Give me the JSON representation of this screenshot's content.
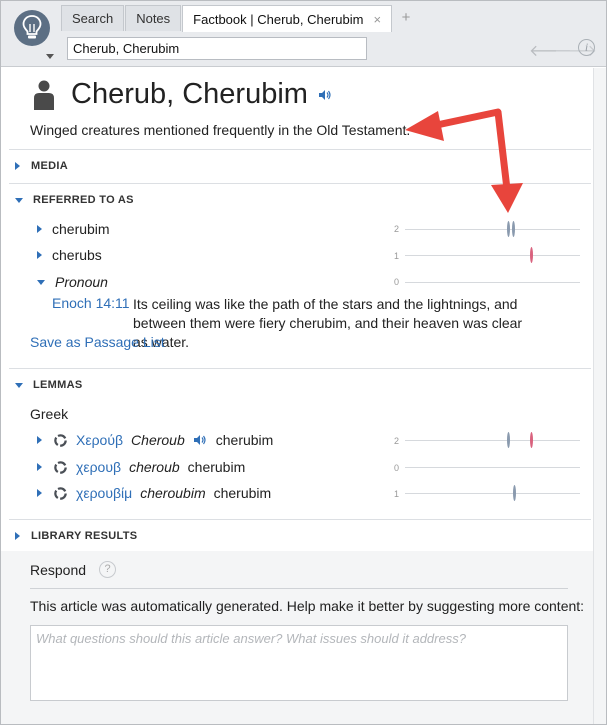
{
  "tabs": [
    {
      "label": "Search"
    },
    {
      "label": "Notes"
    },
    {
      "label": "Factbook | Cherub, Cherubim",
      "active": true
    }
  ],
  "tab_close": "×",
  "tab_add": "+",
  "search": {
    "value": "Cherub, Cherubim"
  },
  "nav": {
    "back": "🡐",
    "forward": "🡒",
    "info": "i"
  },
  "article": {
    "title": "Cherub, Cherubim",
    "description": "Winged creatures mentioned frequently in the Old Testament."
  },
  "sections": {
    "media": "MEDIA",
    "referred_to_as": "REFERRED TO AS",
    "lemmas": "LEMMAS",
    "library_results": "LIBRARY RESULTS"
  },
  "referred": [
    {
      "label": "cherubim",
      "count": "2",
      "italic": false,
      "marks": [
        {
          "pos": 0.59,
          "color": "#8a9aae"
        },
        {
          "pos": 0.615,
          "color": "#8a9aae"
        }
      ]
    },
    {
      "label": "cherubs",
      "count": "1",
      "italic": false,
      "marks": [
        {
          "pos": 0.72,
          "color": "#d9627e"
        }
      ]
    },
    {
      "label": "Pronoun",
      "count": "0",
      "italic": true,
      "marks": []
    }
  ],
  "passage": {
    "reference": "Enoch 14:11",
    "text": "Its ceiling was like the path of the stars and the lightnings, and between them were fiery cherubim, and their heaven was clear as water."
  },
  "save_passage_list": "Save as Passage List",
  "lemmas_label": "Greek",
  "lemmas": [
    {
      "greek": "Χερούβ",
      "translit": "Cheroub",
      "gloss": "cherubim",
      "count": "2",
      "audio": true,
      "marks": [
        {
          "pos": 0.59,
          "color": "#8a9aae"
        },
        {
          "pos": 0.72,
          "color": "#d9627e"
        }
      ]
    },
    {
      "greek": "χερουβ",
      "translit": "cheroub",
      "gloss": "cherubim",
      "count": "0",
      "audio": false,
      "marks": []
    },
    {
      "greek": "χερουβίμ",
      "translit": "cheroubim",
      "gloss": "cherubim",
      "count": "1",
      "audio": false,
      "marks": [
        {
          "pos": 0.62,
          "color": "#8a9aae"
        }
      ]
    }
  ],
  "respond": {
    "title": "Respond",
    "help": "?",
    "intro": "This article was automatically generated. Help make it better by suggesting more content:",
    "placeholder": "What questions should this article answer? What issues should it address?"
  },
  "colors": {
    "accent": "#2f6fb7",
    "callout": "#e8453c",
    "tick_gray": "#8a9aae",
    "tick_pink": "#d9627e"
  }
}
